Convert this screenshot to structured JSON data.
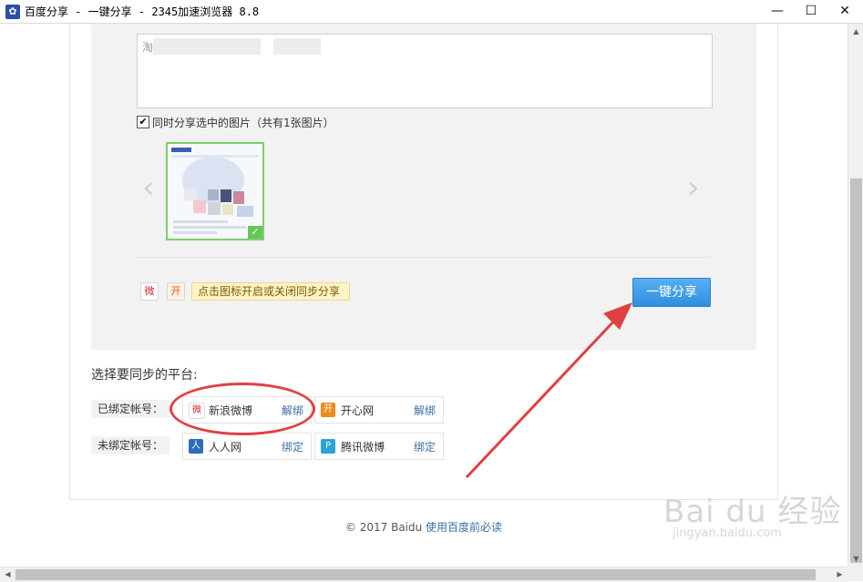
{
  "window": {
    "title": "百度分享 - 一键分享 - 2345加速浏览器 8.8",
    "icon": "baidu-paw-icon",
    "minimize": "—",
    "maximize": "☐",
    "close": "✕"
  },
  "share_form": {
    "textarea_text": "淘                                          度经验",
    "include_images_label": "同时分享选中的图片（共有1张图片）",
    "include_images_checked": true,
    "carousel_prev": "‹",
    "carousel_next": "›",
    "thumbnail_check": "✓",
    "sync_tip": "点击图标开启或关闭同步分享",
    "share_button": "一键分享"
  },
  "platforms": {
    "title": "选择要同步的平台:",
    "bound_label": "已绑定帐号：",
    "unbound_label": "未绑定帐号：",
    "bound": [
      {
        "name": "新浪微博",
        "action": "解绑",
        "icon": "sina-weibo-icon"
      },
      {
        "name": "开心网",
        "action": "解绑",
        "icon": "kaixin-icon"
      }
    ],
    "unbound": [
      {
        "name": "人人网",
        "action": "绑定",
        "icon": "renren-icon"
      },
      {
        "name": "腾讯微博",
        "action": "绑定",
        "icon": "tencent-weibo-icon"
      }
    ]
  },
  "footer": {
    "copyright": "© 2017 Baidu ",
    "link": "使用百度前必读"
  },
  "watermark": {
    "logo": "Bai du 经验",
    "url": "jingyan.baidu.com"
  },
  "colors": {
    "accent_blue": "#3a8ee6",
    "annotation_red": "#e04040",
    "selected_green": "#7cd16a"
  }
}
